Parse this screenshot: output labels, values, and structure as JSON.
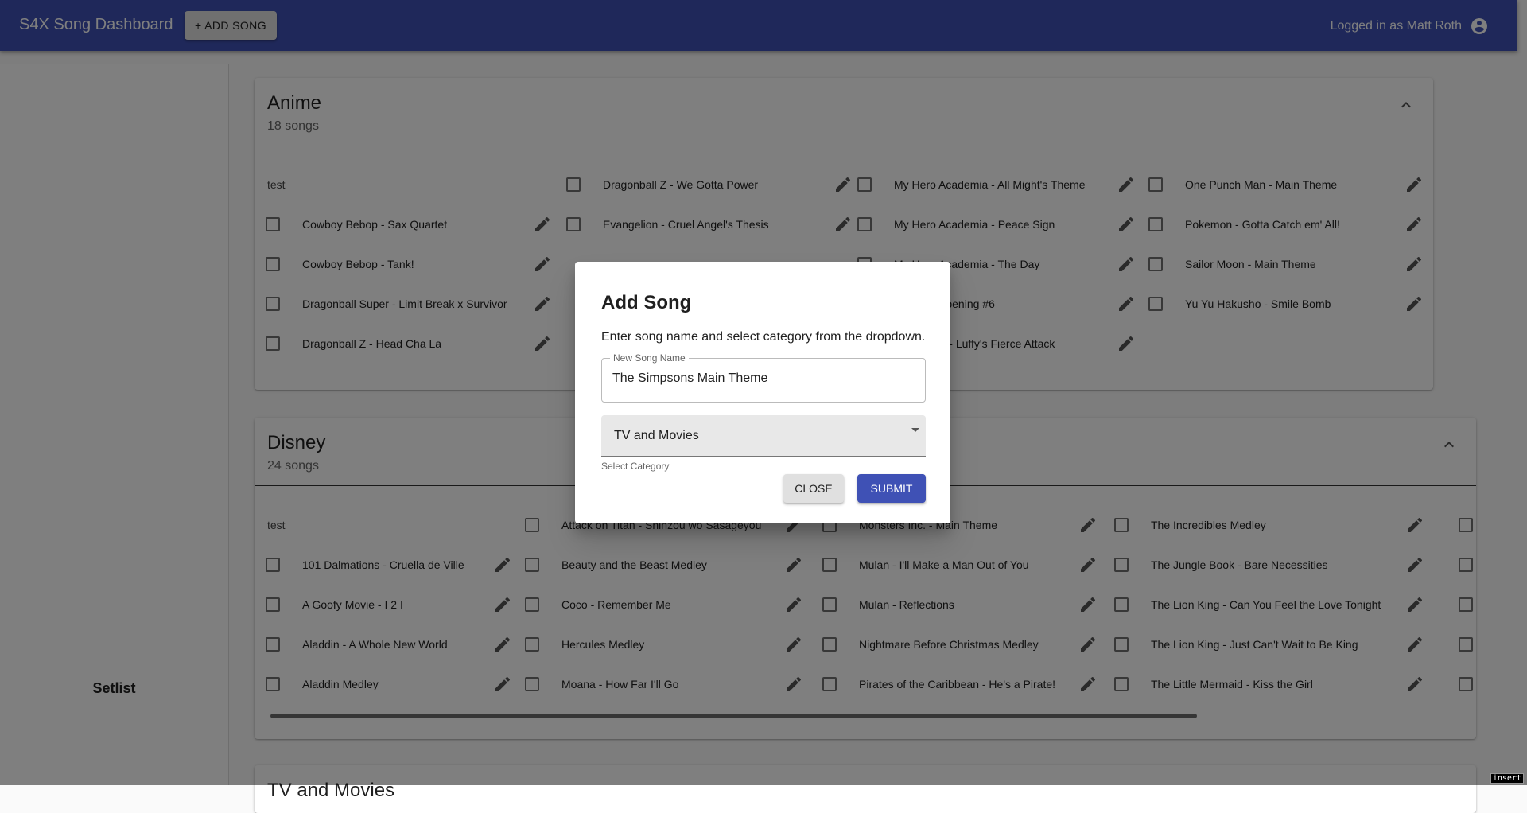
{
  "appbar": {
    "title": "S4X Song Dashboard",
    "add_song_label": "+ ADD SONG",
    "user_label": "Logged in as Matt Roth"
  },
  "sidebar": {
    "setlist_label": "Setlist"
  },
  "categories": [
    {
      "title": "Anime",
      "count": "18 songs",
      "header_label": "test",
      "columns": [
        [
          "Cowboy Bebop - Sax Quartet",
          "Cowboy Bebop - Tank!",
          "Dragonball Super - Limit Break x Survivor",
          "Dragonball Z - Head Cha La"
        ],
        [
          "Dragonball Z - We Gotta Power",
          "Evangelion - Cruel Angel's Thesis",
          "",
          "",
          ""
        ],
        [
          "My Hero Academia - All Might's Theme",
          "My Hero Academia - Peace Sign",
          "My Hero Academia - The Day",
          "Naruto - Opening #6",
          "One Piece - Luffy's Fierce Attack"
        ],
        [
          "One Punch Man - Main Theme",
          "Pokemon - Gotta Catch em' All!",
          "Sailor Moon - Main Theme",
          "Yu Yu Hakusho - Smile Bomb"
        ]
      ]
    },
    {
      "title": "Disney",
      "count": "24 songs",
      "header_label": "test",
      "columns": [
        [
          "101 Dalmations - Cruella de Ville",
          "A Goofy Movie - I 2 I",
          "Aladdin - A Whole New World",
          "Aladdin Medley"
        ],
        [
          "Attack on Titan - Shinzou wo Sasageyou",
          "Beauty and the Beast Medley",
          "Coco - Remember Me",
          "Hercules Medley",
          "Moana - How Far I'll Go"
        ],
        [
          "Monsters Inc. - Main Theme",
          "Mulan - I'll Make a Man Out of You",
          "Mulan - Reflections",
          "Nightmare Before Christmas Medley",
          "Pirates of the Caribbean - He's a Pirate!"
        ],
        [
          "The Incredibles Medley",
          "The Jungle Book - Bare Necessities",
          "The Lion King - Can You Feel the Love Tonight",
          "The Lion King - Just Can't Wait to Be King",
          "The Little Mermaid - Kiss the Girl"
        ]
      ]
    },
    {
      "title": "TV and Movies"
    }
  ],
  "dialog": {
    "title": "Add Song",
    "description": "Enter song name and select category from the dropdown.",
    "name_label": "New Song Name",
    "name_value": "The Simpsons Main Theme",
    "category_value": "TV and Movies",
    "category_helper": "Select Category",
    "close_label": "CLOSE",
    "submit_label": "SUBMIT"
  },
  "status": {
    "insert_label": "insert"
  },
  "colors": {
    "primary": "#3f51b5",
    "button_grey": "#e0e0e0"
  }
}
